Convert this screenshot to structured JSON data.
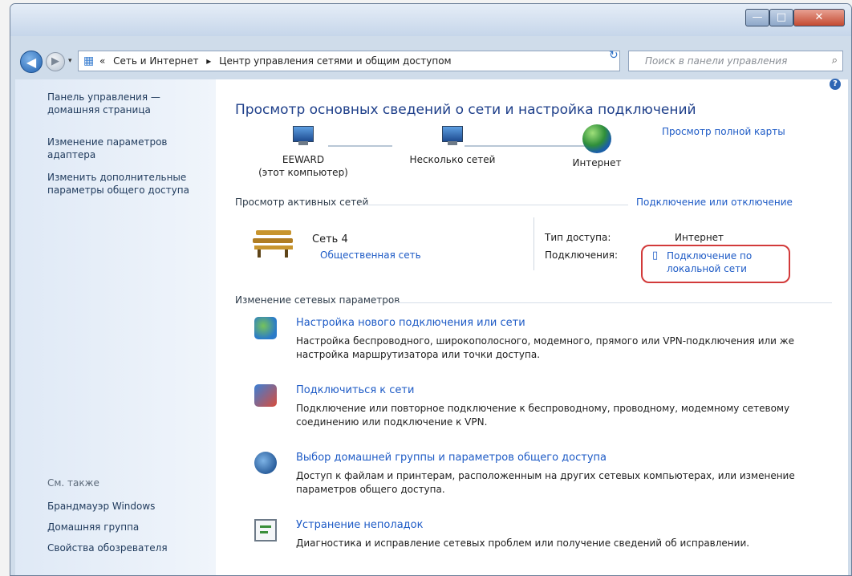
{
  "window": {
    "controls": {
      "minimize": "—",
      "maximize": "□",
      "close": "✕"
    }
  },
  "navbar": {
    "back": "◀",
    "forward": "▶",
    "dropdown": "▾",
    "breadcrumb": [
      "«",
      "Сеть и Интернет",
      "▸",
      "Центр управления сетями и общим доступом"
    ],
    "address_dropdown": "▾",
    "refresh": "↻",
    "search_placeholder": "Поиск в панели управления",
    "search_icon": "⌕"
  },
  "sidebar": {
    "links": [
      "Панель управления — домашняя страница",
      "Изменение параметров адаптера",
      "Изменить дополнительные параметры общего доступа"
    ],
    "see_also_heading": "См. также",
    "see_also": [
      "Брандмауэр Windows",
      "Домашняя группа",
      "Свойства обозревателя"
    ]
  },
  "help_icon": "?",
  "main": {
    "title": "Просмотр основных сведений о сети и настройка подключений",
    "full_map_link": "Просмотр полной карты",
    "map_nodes": [
      {
        "name": "EEWARD",
        "sub": "(этот компьютер)",
        "icon": "computer-icon"
      },
      {
        "name": "Несколько сетей",
        "sub": "",
        "icon": "network-icon"
      },
      {
        "name": "Интернет",
        "sub": "",
        "icon": "globe-icon"
      }
    ],
    "active_networks_heading": "Просмотр активных сетей",
    "connect_disconnect_link": "Подключение или отключение",
    "network": {
      "name": "Сеть 4",
      "type": "Общественная сеть",
      "access_type_label": "Тип доступа:",
      "access_type_value": "Интернет",
      "connections_label": "Подключения:",
      "connection_link": "Подключение по локальной сети",
      "connection_icon": "▯"
    },
    "change_settings_heading": "Изменение сетевых параметров",
    "tasks": [
      {
        "icon": "network-setup-icon",
        "link": "Настройка нового подключения или сети",
        "desc": "Настройка беспроводного, широкополосного, модемного, прямого или VPN-подключения или же настройка маршрутизатора или точки доступа."
      },
      {
        "icon": "connect-network-icon",
        "link": "Подключиться к сети",
        "desc": "Подключение или повторное подключение к беспроводному, проводному, модемному сетевому соединению или подключение к VPN."
      },
      {
        "icon": "homegroup-icon",
        "link": "Выбор домашней группы и параметров общего доступа",
        "desc": "Доступ к файлам и принтерам, расположенным на других сетевых компьютерах, или изменение параметров общего доступа."
      },
      {
        "icon": "troubleshoot-icon",
        "link": "Устранение неполадок",
        "desc": "Диагностика и исправление сетевых проблем или получение сведений об исправлении."
      }
    ]
  },
  "colors": {
    "link": "#1e5bc6",
    "title": "#1e3f8a",
    "highlight": "#d23a3a"
  }
}
